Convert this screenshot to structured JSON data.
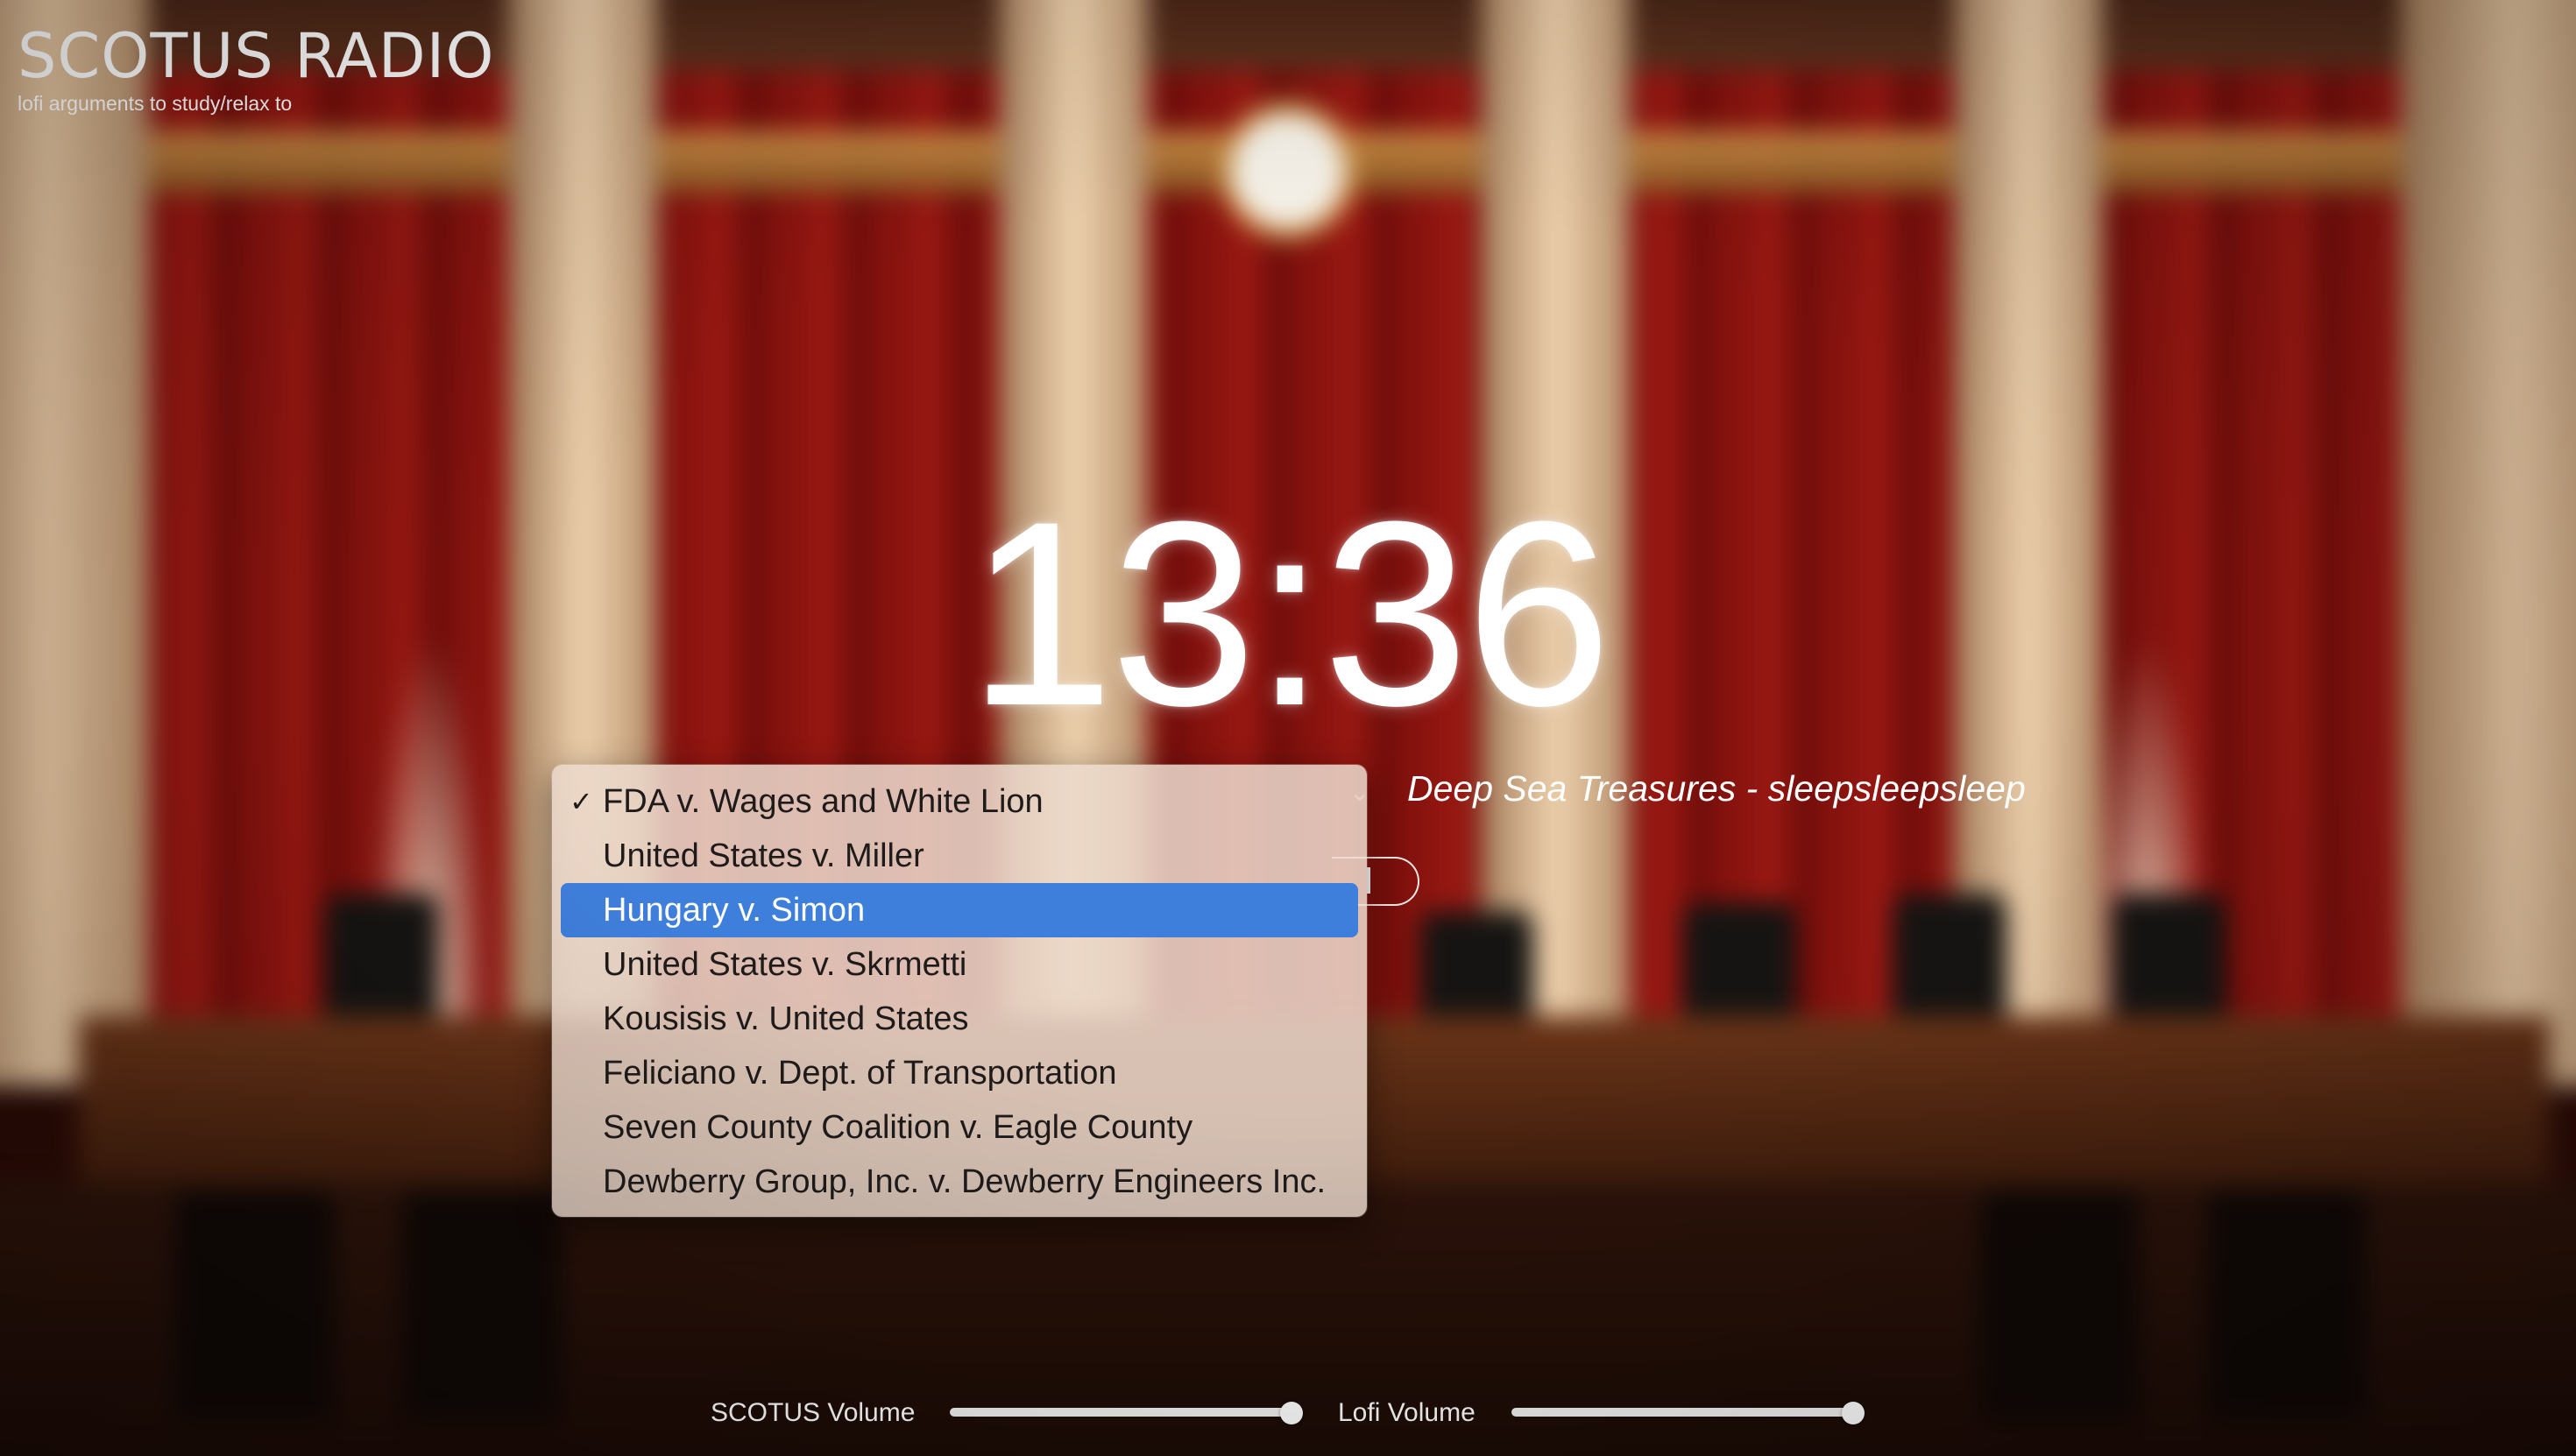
{
  "brand": {
    "title": "SCOTUS RADIO",
    "subtitle": "lofi arguments to study/relax to"
  },
  "clock": {
    "time": "13:36"
  },
  "now_playing": {
    "track": "Deep Sea Treasures - sleepsleepsleep"
  },
  "case_menu": {
    "selected_index": 0,
    "highlighted_index": 2,
    "check_glyph": "✓",
    "items": [
      "FDA v. Wages and White Lion",
      "United States v. Miller",
      "Hungary v. Simon",
      "United States v. Skrmetti",
      "Kousisis v. United States",
      "Feliciano v. Dept. of Transportation",
      "Seven County Coalition v. Eagle County",
      "Dewberry Group, Inc. v. Dewberry Engineers Inc."
    ]
  },
  "volume": {
    "scotus_label": "SCOTUS Volume",
    "scotus_level": 1.0,
    "lofi_label": "Lofi Volume",
    "lofi_level": 1.0
  },
  "colors": {
    "highlight": "#3f7fdc",
    "curtain": "#8a1410",
    "column": "#c9a27a",
    "text": "#ffffff"
  },
  "icons": {
    "check": "checkmark-icon",
    "chevron": "chevron-down-icon",
    "play": "pause-icon"
  }
}
